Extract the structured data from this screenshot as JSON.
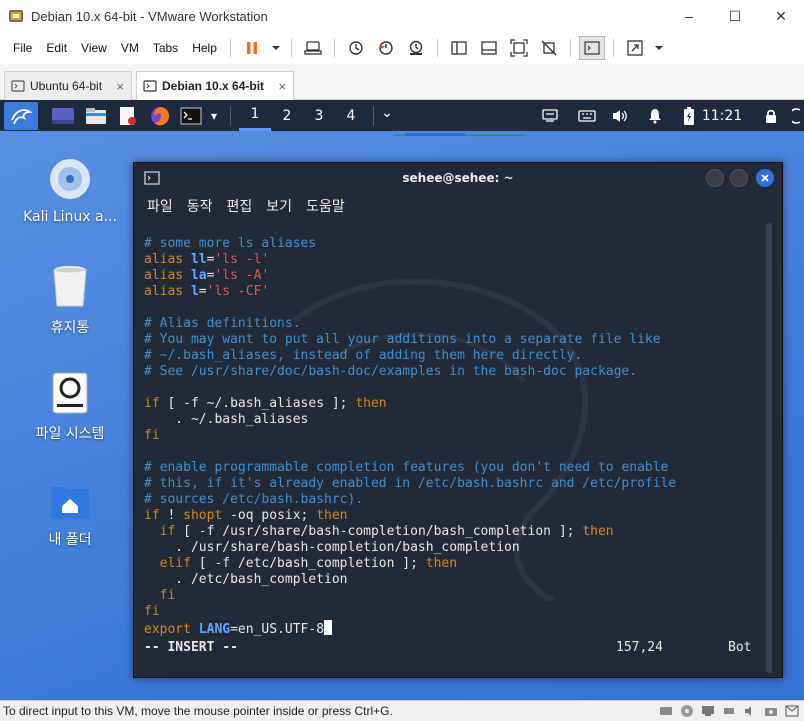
{
  "window": {
    "title": "Debian 10.x 64-bit - VMware Workstation",
    "minimize": "–",
    "maximize": "☐",
    "close": "✕"
  },
  "menu": [
    "File",
    "Edit",
    "View",
    "VM",
    "Tabs",
    "Help"
  ],
  "tabs": [
    {
      "label": "Ubuntu 64-bit",
      "close": "×"
    },
    {
      "label": "Debian 10.x 64-bit",
      "close": "×"
    }
  ],
  "panel": {
    "workspaces": [
      "1",
      "2",
      "3",
      "4"
    ],
    "clock": "11:21",
    "menu_chevron": "⌄"
  },
  "desktop_icons": [
    {
      "label": "Kali Linux a..."
    },
    {
      "label": "휴지통"
    },
    {
      "label": "파일 시스템"
    },
    {
      "label": "내 폴더"
    }
  ],
  "terminal": {
    "title": "sehee@sehee: ~",
    "menu": [
      "파일",
      "동작",
      "편집",
      "보기",
      "도움말"
    ],
    "status": {
      "mode": "-- INSERT --",
      "position": "157,24",
      "scroll": "Bot"
    }
  },
  "statusbar": {
    "text": "To direct input to this VM, move the mouse pointer inside or press Ctrl+G."
  },
  "colors": {
    "terminal_bg": "#232a37",
    "comment": "#3d8fd4",
    "keyword": "#d7871f",
    "string": "#e05a5a",
    "variable": "#5fa8ff",
    "panel_bg": "#202a3d",
    "desktop_bg": "#4a86dd"
  }
}
